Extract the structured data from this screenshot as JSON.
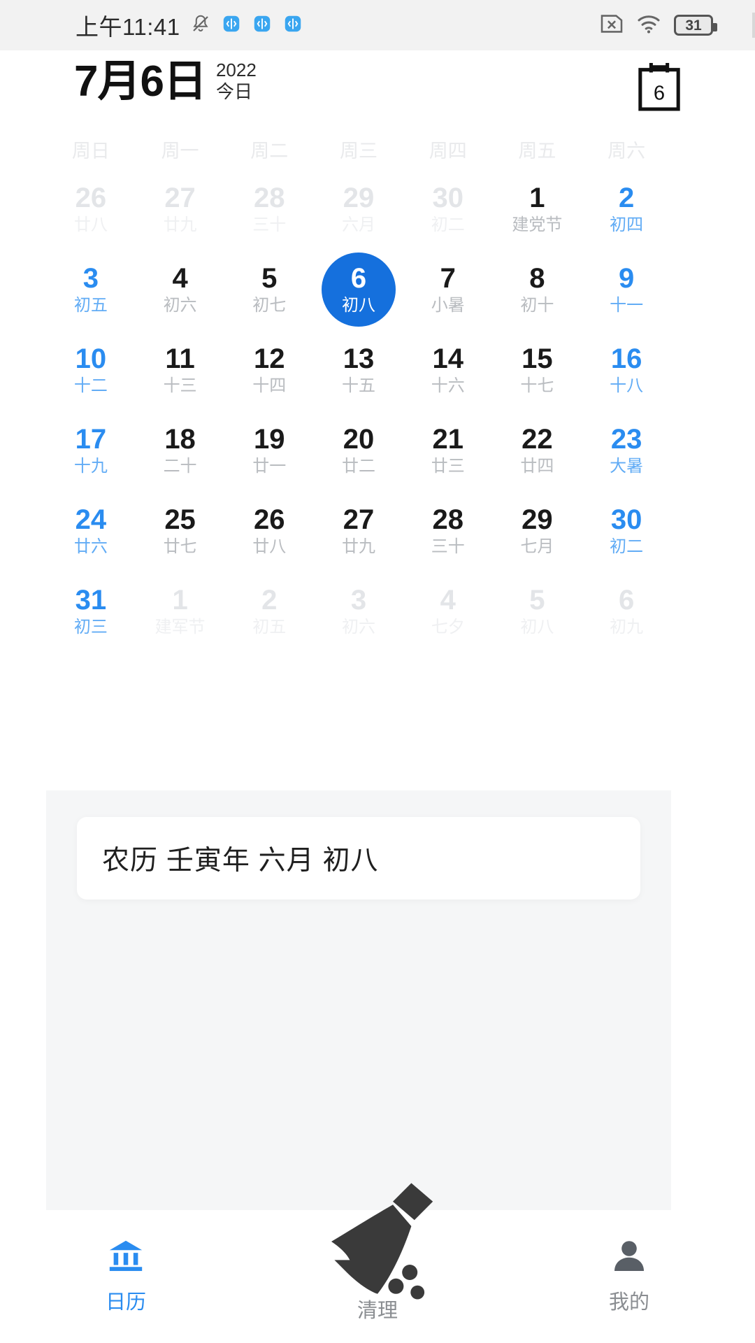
{
  "status_bar": {
    "time": "上午11:41",
    "battery_level": "31",
    "icons": [
      "mute-bell-icon",
      "sim-card-blue-icon",
      "sim-card-blue-icon",
      "sim-card-blue-icon",
      "sim-x-icon",
      "wifi-icon",
      "battery-icon"
    ]
  },
  "header": {
    "date_title": "7月6日",
    "year": "2022",
    "today_label": "今日",
    "calendar_icon_day": "6"
  },
  "calendar": {
    "weekdays": [
      "周日",
      "周一",
      "周二",
      "周三",
      "周四",
      "周五",
      "周六"
    ],
    "days": [
      {
        "d": "26",
        "l": "廿八",
        "out": true,
        "weekend": true,
        "sel": false
      },
      {
        "d": "27",
        "l": "廿九",
        "out": true,
        "weekend": false,
        "sel": false
      },
      {
        "d": "28",
        "l": "三十",
        "out": true,
        "weekend": false,
        "sel": false
      },
      {
        "d": "29",
        "l": "六月",
        "out": true,
        "weekend": false,
        "sel": false
      },
      {
        "d": "30",
        "l": "初二",
        "out": true,
        "weekend": false,
        "sel": false
      },
      {
        "d": "1",
        "l": "建党节",
        "out": false,
        "weekend": false,
        "sel": false
      },
      {
        "d": "2",
        "l": "初四",
        "out": false,
        "weekend": true,
        "sel": false
      },
      {
        "d": "3",
        "l": "初五",
        "out": false,
        "weekend": true,
        "sel": false
      },
      {
        "d": "4",
        "l": "初六",
        "out": false,
        "weekend": false,
        "sel": false
      },
      {
        "d": "5",
        "l": "初七",
        "out": false,
        "weekend": false,
        "sel": false
      },
      {
        "d": "6",
        "l": "初八",
        "out": false,
        "weekend": false,
        "sel": true
      },
      {
        "d": "7",
        "l": "小暑",
        "out": false,
        "weekend": false,
        "sel": false
      },
      {
        "d": "8",
        "l": "初十",
        "out": false,
        "weekend": false,
        "sel": false
      },
      {
        "d": "9",
        "l": "十一",
        "out": false,
        "weekend": true,
        "sel": false
      },
      {
        "d": "10",
        "l": "十二",
        "out": false,
        "weekend": true,
        "sel": false
      },
      {
        "d": "11",
        "l": "十三",
        "out": false,
        "weekend": false,
        "sel": false
      },
      {
        "d": "12",
        "l": "十四",
        "out": false,
        "weekend": false,
        "sel": false
      },
      {
        "d": "13",
        "l": "十五",
        "out": false,
        "weekend": false,
        "sel": false
      },
      {
        "d": "14",
        "l": "十六",
        "out": false,
        "weekend": false,
        "sel": false
      },
      {
        "d": "15",
        "l": "十七",
        "out": false,
        "weekend": false,
        "sel": false
      },
      {
        "d": "16",
        "l": "十八",
        "out": false,
        "weekend": true,
        "sel": false
      },
      {
        "d": "17",
        "l": "十九",
        "out": false,
        "weekend": true,
        "sel": false
      },
      {
        "d": "18",
        "l": "二十",
        "out": false,
        "weekend": false,
        "sel": false
      },
      {
        "d": "19",
        "l": "廿一",
        "out": false,
        "weekend": false,
        "sel": false
      },
      {
        "d": "20",
        "l": "廿二",
        "out": false,
        "weekend": false,
        "sel": false
      },
      {
        "d": "21",
        "l": "廿三",
        "out": false,
        "weekend": false,
        "sel": false
      },
      {
        "d": "22",
        "l": "廿四",
        "out": false,
        "weekend": false,
        "sel": false
      },
      {
        "d": "23",
        "l": "大暑",
        "out": false,
        "weekend": true,
        "sel": false
      },
      {
        "d": "24",
        "l": "廿六",
        "out": false,
        "weekend": true,
        "sel": false
      },
      {
        "d": "25",
        "l": "廿七",
        "out": false,
        "weekend": false,
        "sel": false
      },
      {
        "d": "26",
        "l": "廿八",
        "out": false,
        "weekend": false,
        "sel": false
      },
      {
        "d": "27",
        "l": "廿九",
        "out": false,
        "weekend": false,
        "sel": false
      },
      {
        "d": "28",
        "l": "三十",
        "out": false,
        "weekend": false,
        "sel": false
      },
      {
        "d": "29",
        "l": "七月",
        "out": false,
        "weekend": false,
        "sel": false
      },
      {
        "d": "30",
        "l": "初二",
        "out": false,
        "weekend": true,
        "sel": false
      },
      {
        "d": "31",
        "l": "初三",
        "out": false,
        "weekend": true,
        "sel": false
      },
      {
        "d": "1",
        "l": "建军节",
        "out": true,
        "weekend": false,
        "sel": false
      },
      {
        "d": "2",
        "l": "初五",
        "out": true,
        "weekend": false,
        "sel": false
      },
      {
        "d": "3",
        "l": "初六",
        "out": true,
        "weekend": false,
        "sel": false
      },
      {
        "d": "4",
        "l": "七夕",
        "out": true,
        "weekend": false,
        "sel": false
      },
      {
        "d": "5",
        "l": "初八",
        "out": true,
        "weekend": false,
        "sel": false
      },
      {
        "d": "6",
        "l": "初九",
        "out": true,
        "weekend": true,
        "sel": false
      }
    ]
  },
  "lunar_card": {
    "text": "农历 壬寅年 六月 初八"
  },
  "bottom_nav": {
    "tabs": [
      {
        "label": "日历",
        "icon": "bank-calendar-icon",
        "active": true
      },
      {
        "label": "清理",
        "icon": "broom-icon",
        "active": false
      },
      {
        "label": "我的",
        "icon": "person-icon",
        "active": false
      }
    ]
  },
  "colors": {
    "accent": "#2a8cf0",
    "selected": "#1570dd",
    "muted": "#b9bcc0",
    "statusbar_bg": "#f2f2f2",
    "panel_bg": "#f5f6f7"
  }
}
